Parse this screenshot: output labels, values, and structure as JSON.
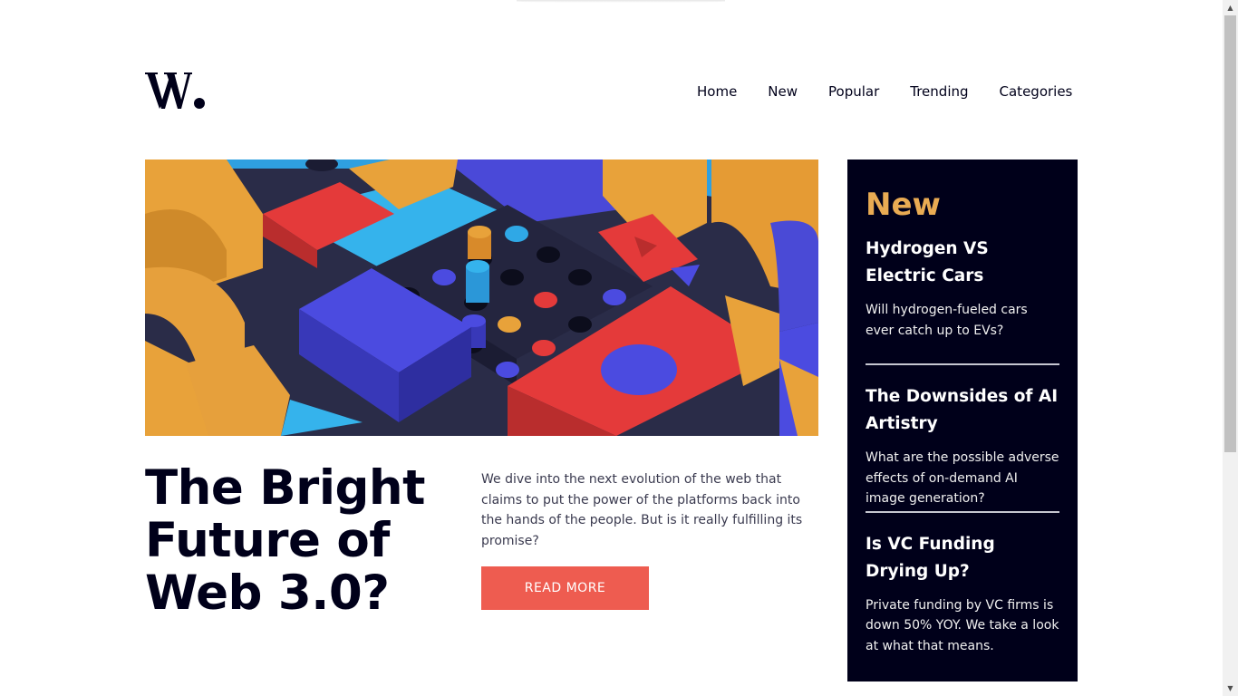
{
  "brand": {
    "logo_text": "W."
  },
  "nav": {
    "items": [
      {
        "label": "Home"
      },
      {
        "label": "New"
      },
      {
        "label": "Popular"
      },
      {
        "label": "Trending"
      },
      {
        "label": "Categories"
      }
    ]
  },
  "hero": {
    "headline": "The Bright Future of Web 3.0?",
    "intro": "We dive into the next evolution of the web that claims to put the power of the platforms back into the hands of the people. But is it really fulfilling its promise?",
    "cta_label": "READ MORE"
  },
  "sidebar": {
    "title": "New",
    "items": [
      {
        "title": "Hydrogen VS Electric Cars",
        "summary": "Will hydrogen-fueled cars ever catch up to EVs?"
      },
      {
        "title": "The Downsides of AI Artistry",
        "summary": "What are the possible adverse effects of on-demand AI image generation?"
      },
      {
        "title": "Is VC Funding Drying Up?",
        "summary": "Private funding by VC firms is down 50% YOY. We take a look at what that means."
      }
    ]
  },
  "colors": {
    "accent_cta": "#ee5c50",
    "sidebar_bg": "#00001a",
    "sidebar_heading": "#e9ab53",
    "text_dark": "#00001a"
  }
}
